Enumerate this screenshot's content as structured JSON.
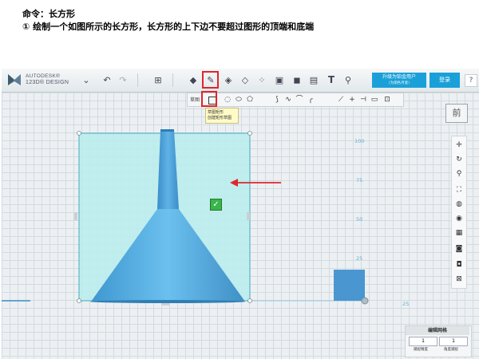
{
  "instructions": {
    "line1": "命令：长方形",
    "line2": "①  绘制一个如图所示的长方形，长方形的上下边不要超过图形的顶端和底端"
  },
  "toolbar": {
    "brand_top": "AUTODESK®",
    "brand_bottom": "123D® DESIGN",
    "promo_label": "升级为铂金用户",
    "promo_sub": "(为期各月套)",
    "login_label": "登录",
    "help_label": "?"
  },
  "sketch_toolbar": {
    "label": "草图"
  },
  "tooltip": {
    "title": "草图矩形",
    "desc": "创建矩形草图"
  },
  "axis": {
    "right_ticks": [
      "100",
      "75",
      "50",
      "25"
    ],
    "bottom_tick": "25"
  },
  "view_cube": {
    "face": "前"
  },
  "snap_panel": {
    "title": "编辑网格",
    "value1": "1",
    "value2": "1",
    "label1": "捕捉精度",
    "label2": "角度捕捉"
  },
  "colors": {
    "accent": "#1aa0d8",
    "highlight": "#e0252c",
    "shape": "#4aa8de",
    "sketch_fill": "#b8ecec"
  },
  "icons": [
    "app-logo-icon",
    "chevron-down-icon",
    "undo-icon",
    "redo-icon",
    "primitives-icon",
    "sketch-icon",
    "construct-icon",
    "modify-icon",
    "pattern-icon",
    "group-icon",
    "combine-icon",
    "measure-icon",
    "text-icon",
    "snap-icon",
    "rectangle-icon",
    "circle-icon",
    "ellipse-icon",
    "polygon-icon",
    "polyline-icon",
    "spline-icon",
    "arc-icon",
    "fillet-icon",
    "trim-icon",
    "extend-icon",
    "offset-icon",
    "project-icon",
    "pan-icon",
    "orbit-icon",
    "zoom-icon",
    "fit-icon",
    "material-icon",
    "visibility-icon",
    "grid-toggle-icon",
    "camera-icon",
    "shaded-icon",
    "mesh-icon",
    "checkmark-icon"
  ]
}
